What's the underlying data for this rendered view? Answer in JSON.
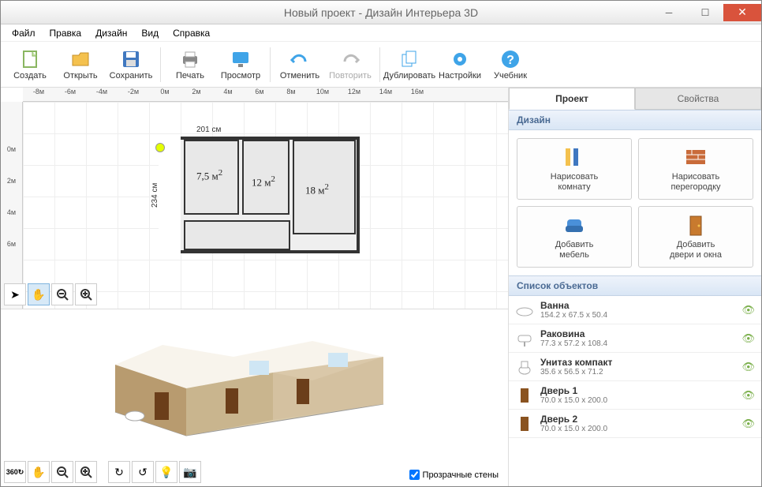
{
  "window": {
    "title": "Новый проект - Дизайн Интерьера 3D"
  },
  "menu": {
    "file": "Файл",
    "edit": "Правка",
    "design": "Дизайн",
    "view": "Вид",
    "help": "Справка"
  },
  "toolbar": {
    "create": "Создать",
    "open": "Открыть",
    "save": "Сохранить",
    "print": "Печать",
    "preview": "Просмотр",
    "undo": "Отменить",
    "redo": "Повторить",
    "duplicate": "Дублировать",
    "settings": "Настройки",
    "tutorial": "Учебник"
  },
  "ruler_h": [
    "-8м",
    "-6м",
    "-4м",
    "-2м",
    "0м",
    "2м",
    "4м",
    "6м",
    "8м",
    "10м",
    "12м",
    "14м",
    "16м"
  ],
  "ruler_v": [
    "0м",
    "2м",
    "4м",
    "6м"
  ],
  "plan": {
    "dim_w": "201 см",
    "dim_h": "234 см",
    "room1": "7,5 м",
    "room2": "12 м",
    "room3": "18 м",
    "sup2": "2"
  },
  "tabs": {
    "project": "Проект",
    "properties": "Свойства"
  },
  "sections": {
    "design": "Дизайн",
    "objects": "Список объектов"
  },
  "cards": {
    "draw_room": "Нарисовать\nкомнату",
    "draw_wall": "Нарисовать\nперегородку",
    "add_furniture": "Добавить\nмебель",
    "add_doors": "Добавить\nдвери и окна"
  },
  "objects": [
    {
      "name": "Ванна",
      "dims": "154.2 x 67.5 x 50.4",
      "icon": "bath"
    },
    {
      "name": "Раковина",
      "dims": "77.3 x 57.2 x 108.4",
      "icon": "sink"
    },
    {
      "name": "Унитаз компакт",
      "dims": "35.6 x 56.5 x 71.2",
      "icon": "toilet"
    },
    {
      "name": "Дверь 1",
      "dims": "70.0 x 15.0 x 200.0",
      "icon": "door"
    },
    {
      "name": "Дверь 2",
      "dims": "70.0 x 15.0 x 200.0",
      "icon": "door"
    }
  ],
  "checkbox": {
    "transparent_walls": "Прозрачные стены"
  }
}
